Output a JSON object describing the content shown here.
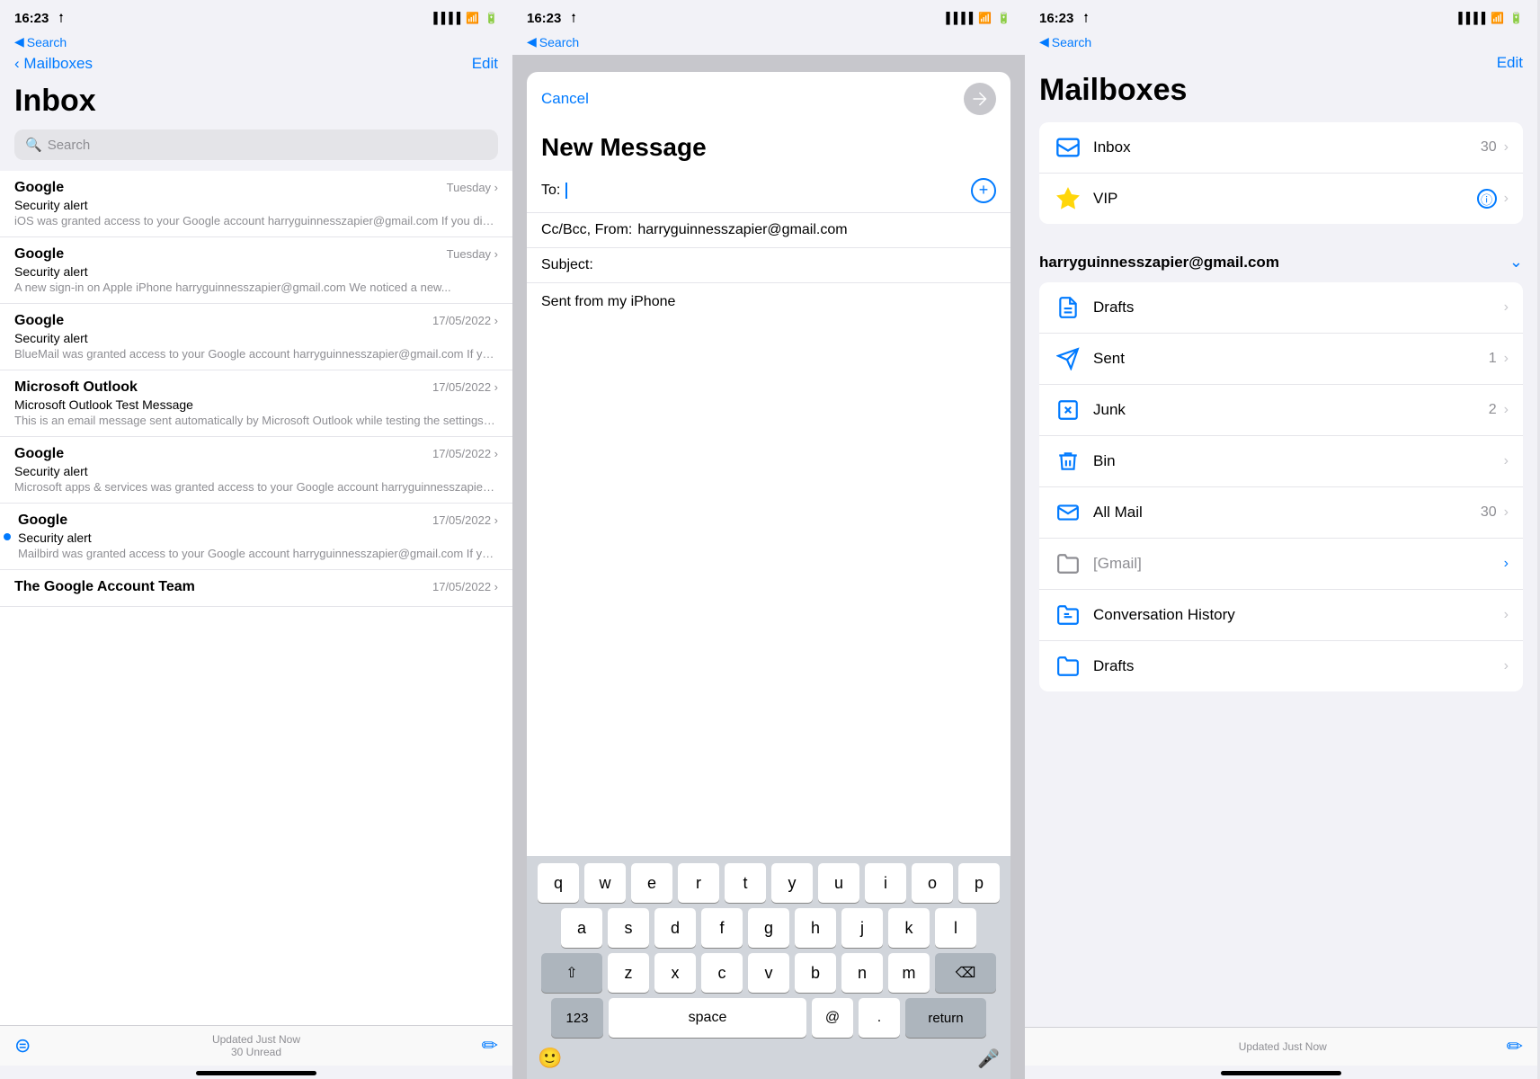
{
  "panels": {
    "inbox": {
      "time": "16:23",
      "back_label": "Search",
      "mailboxes_label": "Mailboxes",
      "edit_label": "Edit",
      "title": "Inbox",
      "search_placeholder": "Search",
      "emails": [
        {
          "sender": "Google",
          "date": "Tuesday",
          "subject": "Security alert",
          "preview": "iOS was granted access to your Google account harryguinnesszapier@gmail.com If you did not gran...",
          "unread": false
        },
        {
          "sender": "Google",
          "date": "Tuesday",
          "subject": "Security alert",
          "preview": "A new sign-in on Apple iPhone harryguinnesszapier@gmail.com We noticed a new...",
          "unread": false
        },
        {
          "sender": "Google",
          "date": "17/05/2022",
          "subject": "Security alert",
          "preview": "BlueMail was granted access to your Google account harryguinnesszapier@gmail.com If you did not gran...",
          "unread": false
        },
        {
          "sender": "Microsoft Outlook",
          "date": "17/05/2022",
          "subject": "Microsoft Outlook Test Message",
          "preview": "This is an email message sent automatically by Microsoft Outlook while testing the settings for you...",
          "unread": false
        },
        {
          "sender": "Google",
          "date": "17/05/2022",
          "subject": "Security alert",
          "preview": "Microsoft apps & services was granted access to your Google account harryguinnesszapier@gmail.c...",
          "unread": false
        },
        {
          "sender": "Google",
          "date": "17/05/2022",
          "subject": "Security alert",
          "preview": "Mailbird was granted access to your Google account harryguinnesszapier@gmail.com If you did not gran...",
          "unread": true
        },
        {
          "sender": "The Google Account Team",
          "date": "17/05/2022",
          "subject": "",
          "preview": "",
          "unread": false
        }
      ],
      "bottom": {
        "status": "Updated Just Now",
        "unread": "30 Unread"
      }
    },
    "compose": {
      "time": "16:23",
      "back_label": "Search",
      "cancel_label": "Cancel",
      "title": "New Message",
      "to_label": "To:",
      "cc_from_label": "Cc/Bcc, From:",
      "from_email": "harryguinnesszapier@gmail.com",
      "subject_label": "Subject:",
      "body": "Sent from my iPhone",
      "keyboard": {
        "row1": [
          "q",
          "w",
          "e",
          "r",
          "t",
          "y",
          "u",
          "i",
          "o",
          "p"
        ],
        "row2": [
          "a",
          "s",
          "d",
          "f",
          "g",
          "h",
          "j",
          "k",
          "l"
        ],
        "row3": [
          "z",
          "x",
          "c",
          "v",
          "b",
          "n",
          "m"
        ],
        "space_label": "space",
        "at_label": "@",
        "period_label": ".",
        "return_label": "return",
        "num_label": "123"
      }
    },
    "mailboxes": {
      "time": "16:23",
      "back_label": "Search",
      "edit_label": "Edit",
      "title": "Mailboxes",
      "top_items": [
        {
          "label": "Inbox",
          "badge": "30",
          "icon": "inbox"
        },
        {
          "label": "VIP",
          "badge": "",
          "icon": "vip",
          "info": true
        }
      ],
      "account_email": "harryguinnesszapier@gmail.com",
      "account_items": [
        {
          "label": "Drafts",
          "badge": "",
          "icon": "drafts"
        },
        {
          "label": "Sent",
          "badge": "1",
          "icon": "sent"
        },
        {
          "label": "Junk",
          "badge": "2",
          "icon": "junk"
        },
        {
          "label": "Bin",
          "badge": "",
          "icon": "bin"
        },
        {
          "label": "All Mail",
          "badge": "30",
          "icon": "allmail"
        },
        {
          "label": "[Gmail]",
          "badge": "",
          "icon": "gmail",
          "blue_chevron": true
        },
        {
          "label": "Conversation History",
          "badge": "",
          "icon": "history"
        },
        {
          "label": "Drafts",
          "badge": "",
          "icon": "folder"
        }
      ],
      "bottom": {
        "status": "Updated Just Now"
      }
    }
  }
}
